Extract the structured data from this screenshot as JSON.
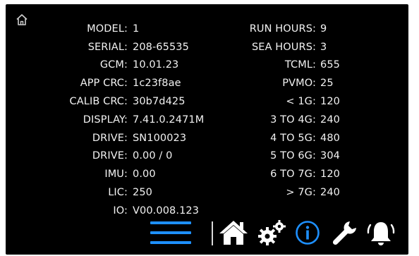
{
  "icons": {
    "corner": "home-outline-icon",
    "menu": "hamburger-menu-icon",
    "home": "home-icon",
    "settings": "gears-icon",
    "info": "info-icon",
    "tools": "wrench-icon",
    "alarm": "alarm-bell-icon"
  },
  "colors": {
    "background": "#000000",
    "text": "#f2f2f2",
    "accent": "#1e90ff"
  },
  "left_info": [
    {
      "label": "MODEL:",
      "value": "1"
    },
    {
      "label": "SERIAL:",
      "value": "208-65535"
    },
    {
      "label": "GCM:",
      "value": "10.01.23"
    },
    {
      "label": "APP CRC:",
      "value": "1c23f8ae"
    },
    {
      "label": "CALIB CRC:",
      "value": "30b7d425"
    },
    {
      "label": "DISPLAY:",
      "value": "7.41.0.2471M"
    },
    {
      "label": "DRIVE:",
      "value": "SN100023"
    },
    {
      "label": "DRIVE:",
      "value": "0.00 / 0"
    },
    {
      "label": "IMU:",
      "value": "0.00"
    },
    {
      "label": "LIC:",
      "value": "250"
    },
    {
      "label": "IO:",
      "value": "V00.008.123"
    }
  ],
  "right_info": [
    {
      "label": "RUN HOURS:",
      "value": "9"
    },
    {
      "label": "SEA HOURS:",
      "value": "3"
    },
    {
      "label": "TCML:",
      "value": "655"
    },
    {
      "label": "PVMO:",
      "value": "25"
    },
    {
      "label": "< 1G:",
      "value": "120"
    },
    {
      "label": "3 TO 4G:",
      "value": "240"
    },
    {
      "label": "4 TO 5G:",
      "value": "480"
    },
    {
      "label": "5 TO 6G:",
      "value": "304"
    },
    {
      "label": "6 TO 7G:",
      "value": "120"
    },
    {
      "label": "> 7G:",
      "value": "240"
    }
  ]
}
